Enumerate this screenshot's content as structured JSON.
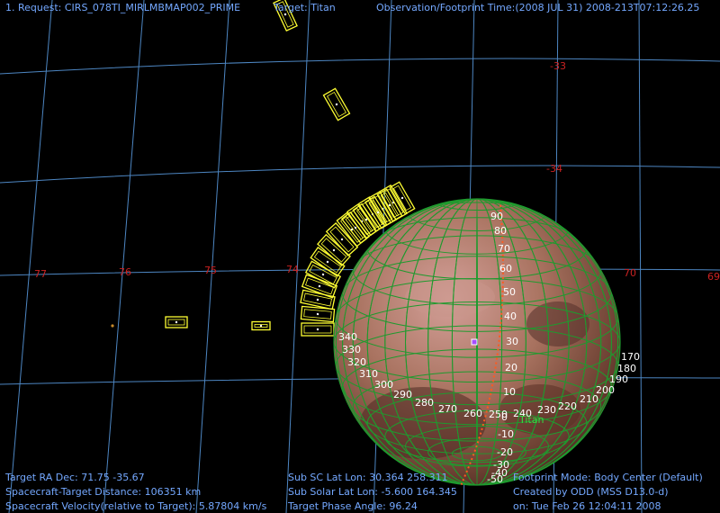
{
  "header": {
    "request": "1. Request: CIRS_078TI_MIRLMBMAP002_PRIME",
    "target": "Target: Titan",
    "obs_time": "Observation/Footprint Time:(2008 JUL 31) 2008-213T07:12:26.25"
  },
  "dec_labels": [
    "-33",
    "-34"
  ],
  "ra_labels": [
    "77",
    "76",
    "75",
    "74",
    "70",
    "69"
  ],
  "lat_labels": [
    "90",
    "80",
    "70",
    "60",
    "50",
    "40",
    "30",
    "20",
    "10",
    "0",
    "-10",
    "-20",
    "-30",
    "-40",
    "-50"
  ],
  "lon_labels": [
    "340",
    "330",
    "320",
    "310",
    "300",
    "290",
    "280",
    "270",
    "260",
    "250",
    "240",
    "230",
    "220",
    "210",
    "200",
    "190",
    "180",
    "170"
  ],
  "body_label": "Titan",
  "footer": {
    "left": [
      "Target RA Dec: 71.75  -35.67",
      "Spacecraft-Target Distance:  106351 km",
      "Spacecraft Velocity(relative to Target): 5.87804 km/s"
    ],
    "middle": [
      "Sub SC Lat Lon: 30.364  258.311",
      "Sub Solar Lat Lon: -5.600  164.345",
      "Target Phase Angle: 96.24"
    ],
    "right": [
      "Footprint Mode: Body Center (Default)",
      "Created by ODD (MSS D13.0-d)",
      "on: Tue Feb 26 12:04:11 2008"
    ]
  },
  "colors": {
    "background": "#000000",
    "grid": "#4d86c2",
    "grid_label": "#cc2222",
    "hud_text": "#74a8ff",
    "footprint": "#ffff33",
    "globe_grid": "#1f9a2e",
    "track": "#ff5a1f",
    "marker": "#a64dff"
  }
}
